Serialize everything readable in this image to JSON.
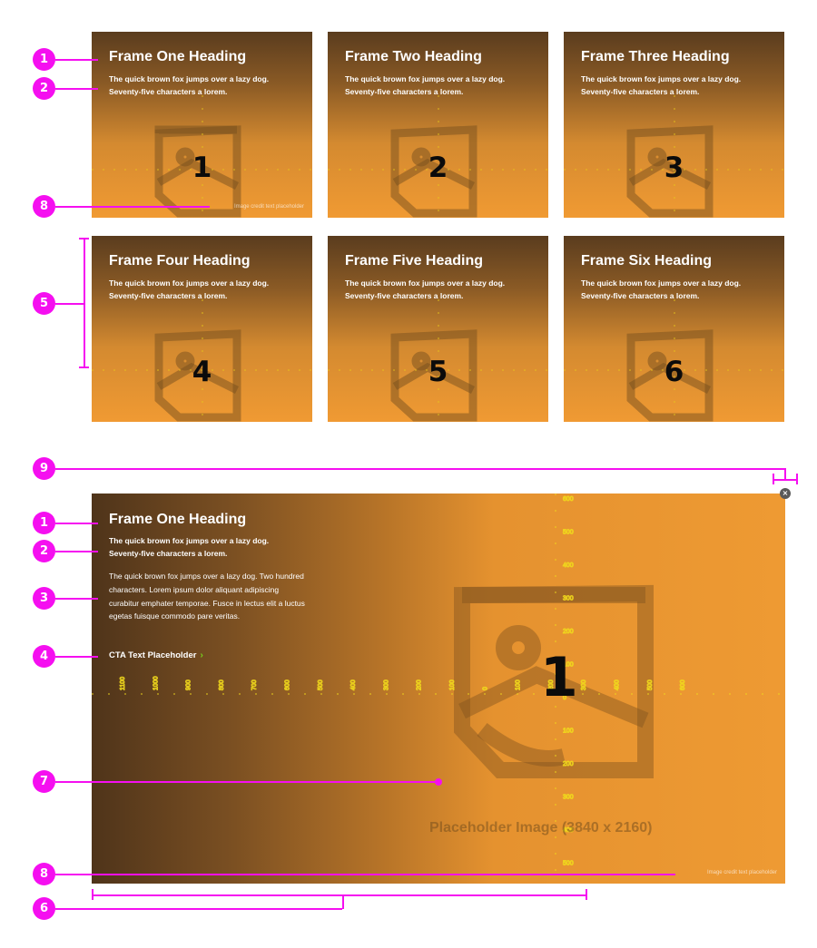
{
  "frames": [
    {
      "heading": "Frame One Heading",
      "subtext": "The quick brown fox jumps over a lazy dog. Seventy-five characters a lorem.",
      "number": "1",
      "credit": "Image credit text placeholder"
    },
    {
      "heading": "Frame Two Heading",
      "subtext": "The quick brown fox jumps over a lazy dog. Seventy-five characters a lorem.",
      "number": "2",
      "credit": ""
    },
    {
      "heading": "Frame Three Heading",
      "subtext": "The quick brown fox jumps over a lazy dog. Seventy-five characters a lorem.",
      "number": "3",
      "credit": ""
    },
    {
      "heading": "Frame Four Heading",
      "subtext": "The quick brown fox jumps over a lazy dog. Seventy-five characters a lorem.",
      "number": "4",
      "credit": ""
    },
    {
      "heading": "Frame Five Heading",
      "subtext": "The quick brown fox jumps over a lazy dog. Seventy-five characters a lorem.",
      "number": "5",
      "credit": ""
    },
    {
      "heading": "Frame Six Heading",
      "subtext": "The quick brown fox jumps over a lazy dog. Seventy-five characters a lorem.",
      "number": "6",
      "credit": ""
    }
  ],
  "expanded": {
    "heading": "Frame One Heading",
    "subtext": "The quick brown fox jumps over a lazy dog. Seventy-five characters a lorem.",
    "body": "The quick brown fox jumps over a lazy dog. Two hundred characters. Lorem ipsum dolor aliquant adipiscing curabitur emphater temporae. Fusce in lectus elit a luctus egetas fuisque commodo pare veritas.",
    "cta": "CTA Text Placeholder",
    "cta_chevron": "›",
    "number": "1",
    "placeholder_text": "Placeholder Image (3840 x 2160)",
    "credit": "Image credit text placeholder",
    "close_glyph": "×"
  },
  "ruler": {
    "vertical_labels": [
      "600",
      "500",
      "400",
      "300",
      "200",
      "100",
      "0",
      "100",
      "200",
      "300",
      "400",
      "500"
    ],
    "horizontal_labels": [
      "1100",
      "1000",
      "900",
      "800",
      "700",
      "600",
      "500",
      "400",
      "300",
      "200",
      "100",
      "0",
      "100",
      "200",
      "300",
      "400",
      "500",
      "600"
    ]
  },
  "markers": [
    "1",
    "2",
    "8",
    "5",
    "9",
    "1",
    "2",
    "3",
    "4",
    "7",
    "8",
    "6"
  ],
  "colors": {
    "marker": "#f50ff0",
    "cta_chevron": "#76d11c",
    "ruler": "#f5e21a"
  },
  "icons": {
    "placeholder": "image-placeholder-icon",
    "close": "close-icon"
  }
}
